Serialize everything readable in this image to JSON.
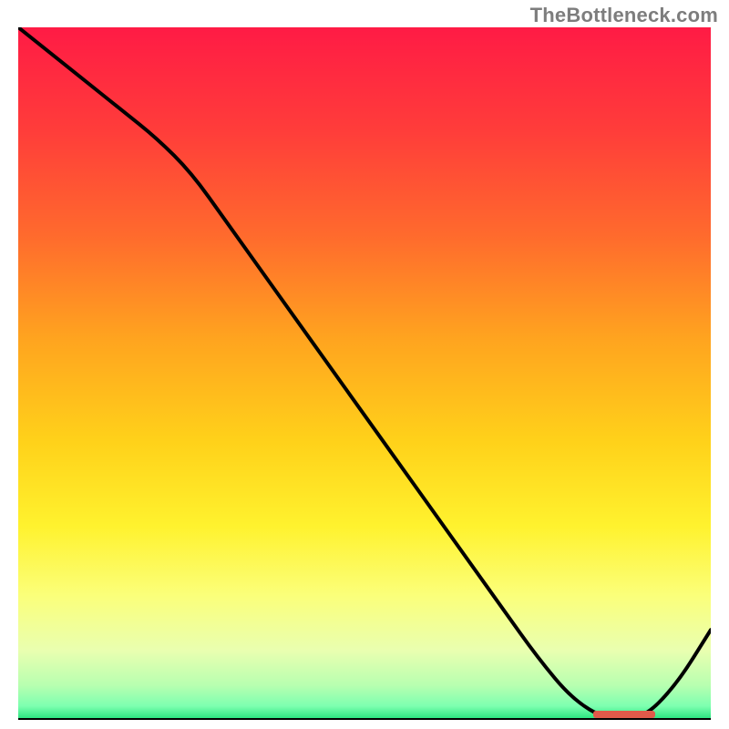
{
  "watermark": "TheBottleneck.com",
  "chart_data": {
    "type": "line",
    "title": "",
    "xlabel": "",
    "ylabel": "",
    "xlim": [
      0,
      100
    ],
    "ylim": [
      0,
      100
    ],
    "x": [
      0,
      5,
      10,
      15,
      20,
      25,
      30,
      35,
      40,
      45,
      50,
      55,
      60,
      65,
      70,
      75,
      80,
      85,
      90,
      95,
      100
    ],
    "y": [
      100,
      96,
      92,
      88,
      84,
      79,
      72,
      65,
      58,
      51,
      44,
      37,
      30,
      23,
      16,
      9,
      3,
      0,
      0,
      5,
      13
    ],
    "optimum_marker": {
      "x_start": 83,
      "x_end": 92,
      "color": "#e05a4a"
    },
    "gradient_stops": [
      {
        "offset": 0,
        "color": "#ff1b45"
      },
      {
        "offset": 15,
        "color": "#ff3d3a"
      },
      {
        "offset": 30,
        "color": "#ff6a2d"
      },
      {
        "offset": 45,
        "color": "#ffa41f"
      },
      {
        "offset": 60,
        "color": "#ffd21a"
      },
      {
        "offset": 72,
        "color": "#fff22e"
      },
      {
        "offset": 82,
        "color": "#fbff7a"
      },
      {
        "offset": 90,
        "color": "#e9ffb0"
      },
      {
        "offset": 95,
        "color": "#b8ffb0"
      },
      {
        "offset": 98,
        "color": "#7dffb0"
      },
      {
        "offset": 100,
        "color": "#22e07a"
      }
    ]
  }
}
